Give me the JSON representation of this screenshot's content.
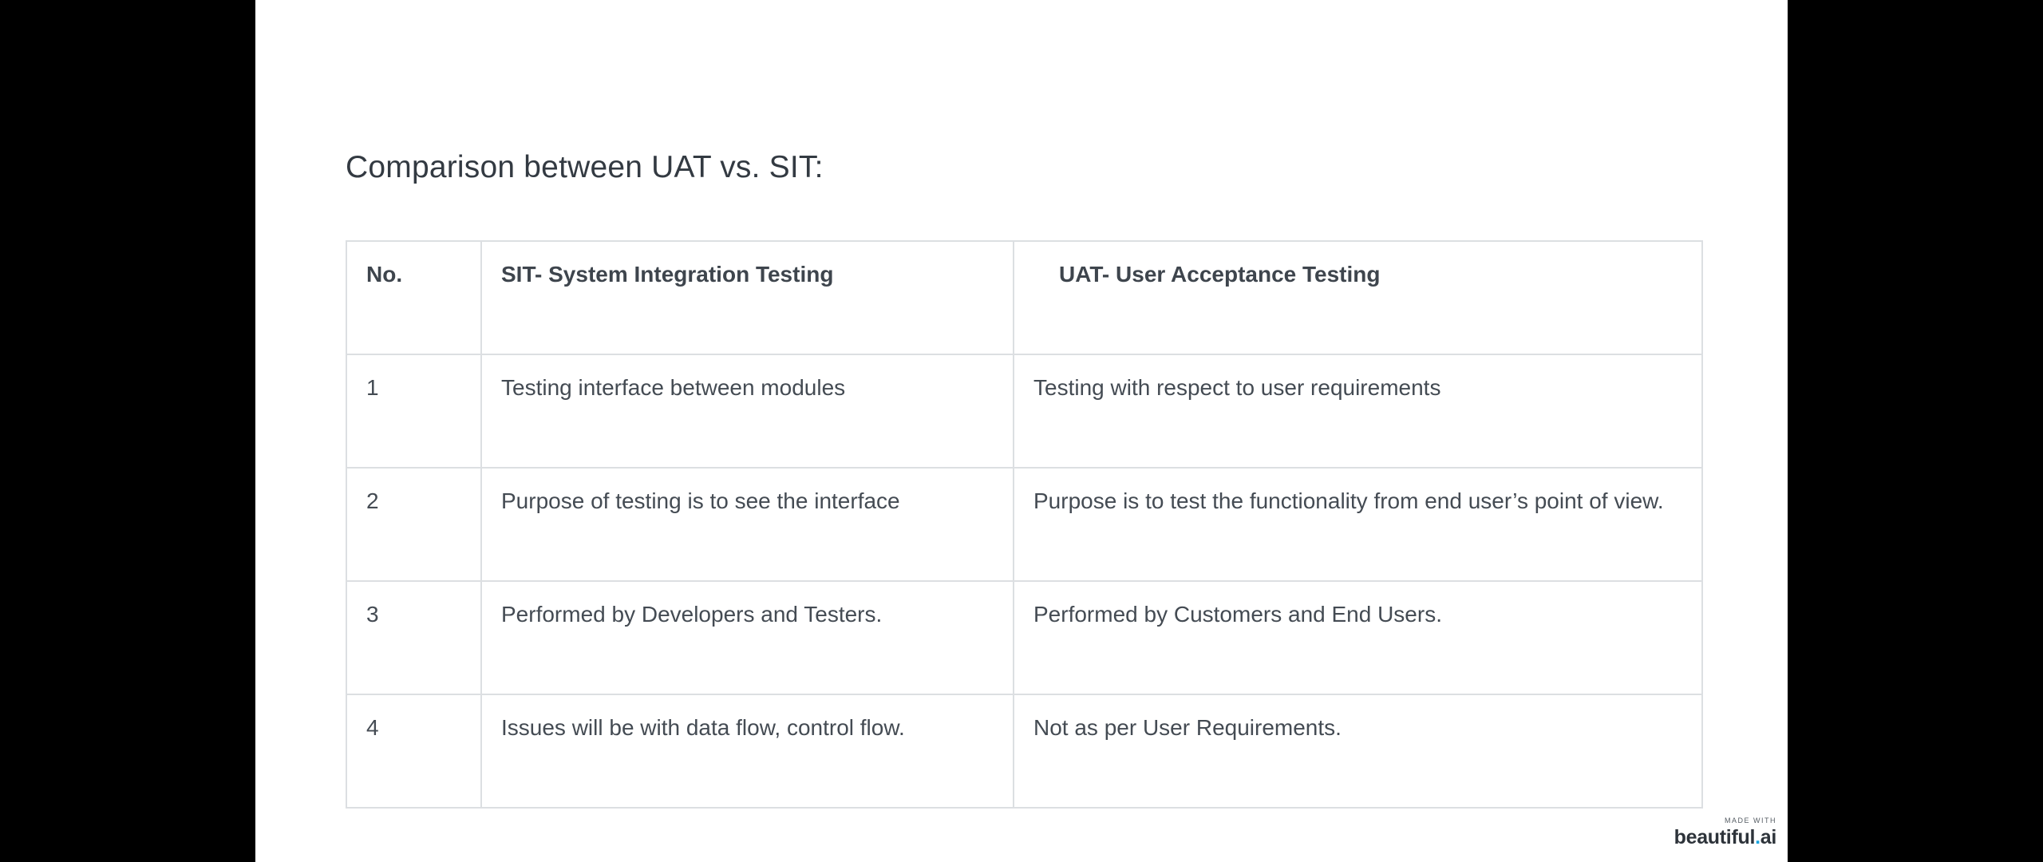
{
  "slide": {
    "title": "Comparison between UAT vs. SIT:"
  },
  "table": {
    "headers": [
      "No.",
      "SIT- System Integration Testing",
      "UAT- User Acceptance Testing"
    ],
    "rows": [
      [
        "1",
        "Testing interface between modules",
        "Testing with respect to user requirements"
      ],
      [
        "2",
        "Purpose of testing is to see the interface",
        "Purpose is to test the functionality from end user’s point of view."
      ],
      [
        "3",
        "Performed by Developers and Testers.",
        "Performed by Customers and End Users."
      ],
      [
        "4",
        "Issues will be with data flow, control flow.",
        "Not as per User Requirements."
      ]
    ]
  },
  "branding": {
    "small_text": "MADE WITH",
    "brand_prefix": "beautiful",
    "brand_dot": ".",
    "brand_suffix": "ai"
  },
  "colors": {
    "background": "#000000",
    "slide": "#ffffff",
    "text": "#444b53",
    "border": "#dcdfe2",
    "brand_accent": "#1aa6e0"
  }
}
